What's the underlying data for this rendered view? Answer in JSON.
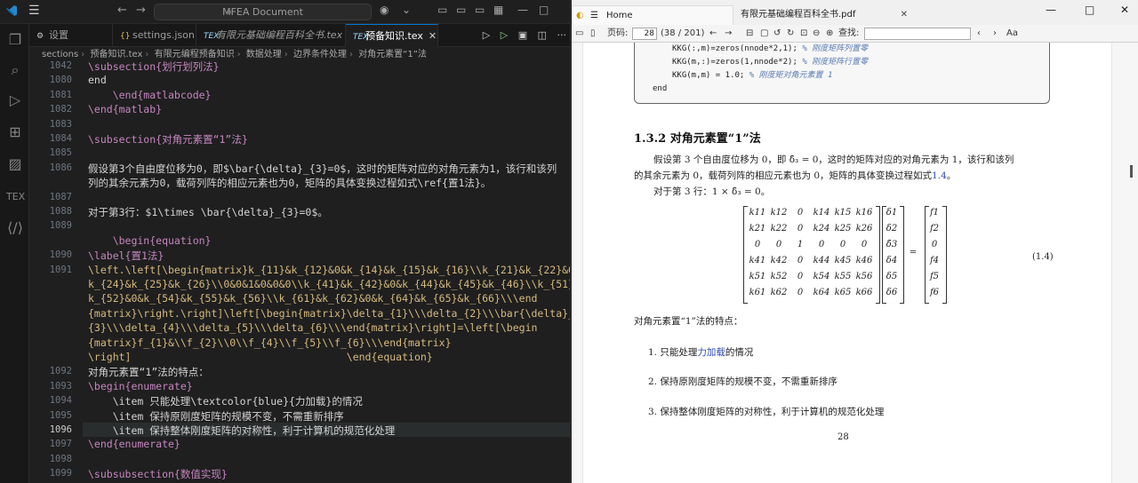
{
  "vscode": {
    "search_label": "MFEA Document",
    "tabs": [
      {
        "label": "设置"
      },
      {
        "label": "settings.json"
      },
      {
        "label": "有限元基础编程百科全书.tex"
      },
      {
        "label": "预备知识.tex"
      }
    ],
    "breadcrumbs": [
      "sections",
      "预备知识.tex",
      "有限元编程预备知识",
      "数据处理",
      "边界条件处理",
      "对角元素置“1”法"
    ],
    "lines": [
      {
        "n": "1042",
        "text": "\\subsection{划行划列法}"
      },
      {
        "n": "1080",
        "text": "end"
      },
      {
        "n": "1081",
        "text": "    \\end{matlabcode}"
      },
      {
        "n": "1082",
        "text": "\\end{matlab}"
      },
      {
        "n": "1083",
        "text": ""
      },
      {
        "n": "1084",
        "text": "\\subsection{对角元素置“1”法}"
      },
      {
        "n": "1085",
        "text": ""
      },
      {
        "n": "1086",
        "text": "假设第3个自由度位移为0，即$\\bar{\\delta}_{3}=0$，这时的矩阵对应的对角元素为1，该行和该列"
      },
      {
        "n": "",
        "text": "列的其余元素为0，载荷列阵的相应元素也为0，矩阵的具体变换过程如式\\ref{置1法}。"
      },
      {
        "n": "1087",
        "text": ""
      },
      {
        "n": "1088",
        "text": "对于第3行：$1\\times \\bar{\\delta}_{3}=0$。"
      },
      {
        "n": "1089",
        "text": ""
      },
      {
        "n": "",
        "text": "    \\begin{equation}"
      },
      {
        "n": "1090",
        "text": "\\label{置1法}"
      },
      {
        "n": "1091",
        "text": "\\left.\\left[\\begin{matrix}k_{11}&k_{12}&0&k_{14}&k_{15}&k_{16}\\\\k_{21}&k_{22}&0&"
      },
      {
        "n": "",
        "text": "k_{24}&k_{25}&k_{26}\\\\0&0&1&0&0&0\\\\k_{41}&k_{42}&0&k_{44}&k_{45}&k_{46}\\\\k_{51}&"
      },
      {
        "n": "",
        "text": "k_{52}&0&k_{54}&k_{55}&k_{56}\\\\k_{61}&k_{62}&0&k_{64}&k_{65}&k_{66}\\\\\\end"
      },
      {
        "n": "",
        "text": "{matrix}\\right.\\right]\\left[\\begin{matrix}\\delta_{1}\\\\\\delta_{2}\\\\\\bar{\\delta}_"
      },
      {
        "n": "",
        "text": "{3}\\\\\\delta_{4}\\\\\\delta_{5}\\\\\\delta_{6}\\\\\\end{matrix}\\right]=\\left[\\begin"
      },
      {
        "n": "",
        "text": "{matrix}f_{1}&\\\\f_{2}\\\\0\\\\f_{4}\\\\f_{5}\\\\f_{6}\\\\\\end{matrix}"
      },
      {
        "n": "",
        "text": "\\right]                                   \\end{equation}"
      },
      {
        "n": "1092",
        "text": "对角元素置“1”法的特点："
      },
      {
        "n": "1093",
        "text": "\\begin{enumerate}"
      },
      {
        "n": "1094",
        "text": "    \\item 只能处理\\textcolor{blue}{力加载}的情况"
      },
      {
        "n": "1095",
        "text": "    \\item 保持原刚度矩阵的规模不变，不需重新排序"
      },
      {
        "n": "1096",
        "text": "    \\item 保持整体刚度矩阵的对称性，利于计算机的规范化处理"
      },
      {
        "n": "1097",
        "text": "\\end{enumerate}"
      },
      {
        "n": "1098",
        "text": ""
      },
      {
        "n": "1099",
        "text": "\\subsubsection{数值实现}"
      }
    ]
  },
  "pdf": {
    "tabs": [
      {
        "label": "Home"
      },
      {
        "label": "有限元基础编程百科全书.pdf"
      }
    ],
    "toolbar": {
      "page_label": "页码:",
      "page_value": "28",
      "page_count": "(38 / 201)",
      "find_label": "查找:"
    },
    "code_lines": [
      {
        "code": "KKG(:,m)=zeros(nnode*2,1);",
        "comment": "% 刚度矩阵列置零"
      },
      {
        "code": "KKG(m,:)=zeros(1,nnode*2);",
        "comment": "% 刚度矩阵行置零"
      },
      {
        "code": "KKG(m,m) = 1.0;",
        "comment": "% 刚度矩对角元素置 1"
      },
      {
        "code": "end",
        "comment": ""
      }
    ],
    "section_title": "1.3.2   对角元素置“1”法",
    "para1_a": "假设第 3 个自由度位移为 0，即 δ̄₃ = 0，这时的矩阵对应的对角元素为 1，该行和该列",
    "para1_b": "的其余元素为 0，载荷列阵的相应元素也为 0，矩阵的具体变换过程如式",
    "para1_ref": "1.4",
    "para1_end": "。",
    "para2": "对于第 3 行：1 × δ̄₃ = 0。",
    "matrix_k": [
      [
        "k11",
        "k12",
        "0",
        "k14",
        "k15",
        "k16"
      ],
      [
        "k21",
        "k22",
        "0",
        "k24",
        "k25",
        "k26"
      ],
      [
        "0",
        "0",
        "1",
        "0",
        "0",
        "0"
      ],
      [
        "k41",
        "k42",
        "0",
        "k44",
        "k45",
        "k46"
      ],
      [
        "k51",
        "k52",
        "0",
        "k54",
        "k55",
        "k56"
      ],
      [
        "k61",
        "k62",
        "0",
        "k64",
        "k65",
        "k66"
      ]
    ],
    "vector_d": [
      "δ1",
      "δ2",
      "δ̄3",
      "δ4",
      "δ5",
      "δ6"
    ],
    "vector_f": [
      "f1",
      "f2",
      "0",
      "f4",
      "f5",
      "f6"
    ],
    "equals": "=",
    "eq_number": "(1.4)",
    "features_title": "对角元素置“1”法的特点：",
    "items": [
      {
        "num": "1.",
        "pre": "只能处理",
        "link": "力加载",
        "post": "的情况"
      },
      {
        "num": "2.",
        "pre": "保持原刚度矩阵的规模不变，不需重新排序",
        "link": "",
        "post": ""
      },
      {
        "num": "3.",
        "pre": "保持整体刚度矩阵的对称性，利于计算机的规范化处理",
        "link": "",
        "post": ""
      }
    ],
    "page_number": "28"
  }
}
